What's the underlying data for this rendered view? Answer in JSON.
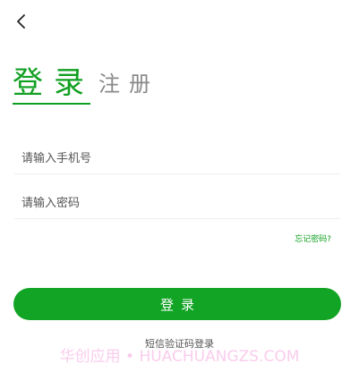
{
  "header": {
    "back_icon": "chevron-left-icon"
  },
  "tabs": {
    "login_label": "登录",
    "register_label": "注册"
  },
  "form": {
    "phone_placeholder": "请输入手机号",
    "password_placeholder": "请输入密码",
    "forgot_label": "忘记密码?"
  },
  "actions": {
    "login_label": "登录",
    "sms_login_label": "短信验证码登录"
  },
  "watermark": {
    "text": "华创应用 • HUACHUANGZS.COM"
  },
  "colors": {
    "accent": "#10a020",
    "button": "#12a425",
    "inactive_tab": "#8a8a8a"
  }
}
